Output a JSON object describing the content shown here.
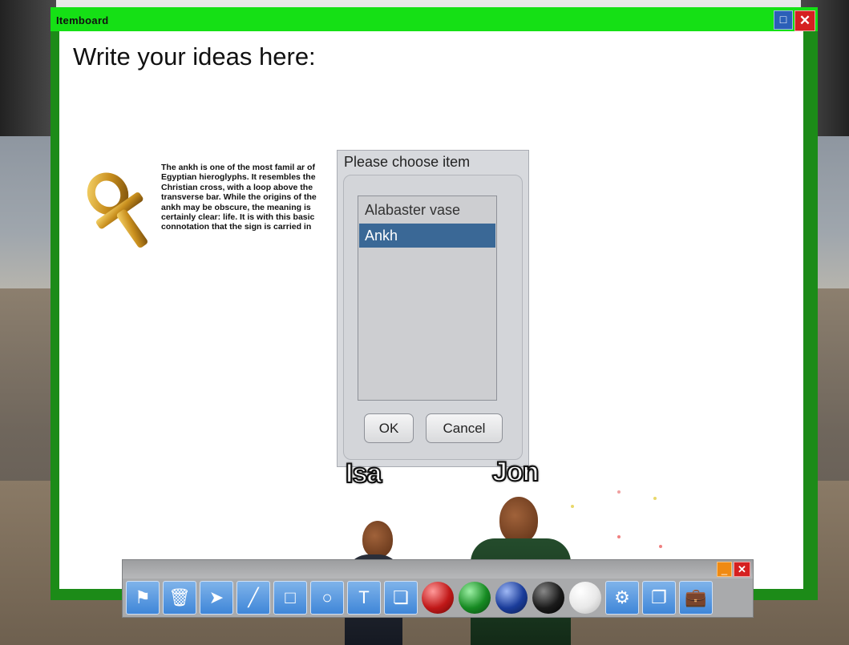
{
  "window": {
    "title": "Itemboard",
    "restore_icon": "restore-icon",
    "close_icon": "close-icon"
  },
  "board": {
    "heading": "Write your ideas here:",
    "image": "ankh-icon",
    "description": "The ankh is one of the most famil ar of Egyptian hieroglyphs. It resembles the Christian cross, with a loop above the transverse bar. While the origins of the ankh may be obscure, the meaning is certainly clear: life. It is with this basic connotation that the sign is carried in"
  },
  "dialog": {
    "title": "Please choose item",
    "items": [
      {
        "label": "Alabaster vase",
        "selected": false
      },
      {
        "label": "Ankh",
        "selected": true
      }
    ],
    "ok_label": "OK",
    "cancel_label": "Cancel"
  },
  "avatars": [
    {
      "name": "Isa"
    },
    {
      "name": "Jon"
    }
  ],
  "toolbar": {
    "minimize_icon": "minimize-icon",
    "close_icon": "close-icon",
    "tools": [
      "flag-icon",
      "trash-icon",
      "pointer-icon",
      "line-icon",
      "rectangle-icon",
      "circle-icon",
      "text-icon",
      "copy-icon"
    ],
    "colors": [
      {
        "name": "red",
        "hex": "#c01818"
      },
      {
        "name": "green",
        "hex": "#168a22"
      },
      {
        "name": "blue",
        "hex": "#1a3c9a"
      },
      {
        "name": "black",
        "hex": "#1a1a1a"
      },
      {
        "name": "white",
        "hex": "#e8e8e8"
      }
    ],
    "extra_tools": [
      "settings-gear-icon",
      "pages-icon",
      "bag-icon"
    ]
  }
}
